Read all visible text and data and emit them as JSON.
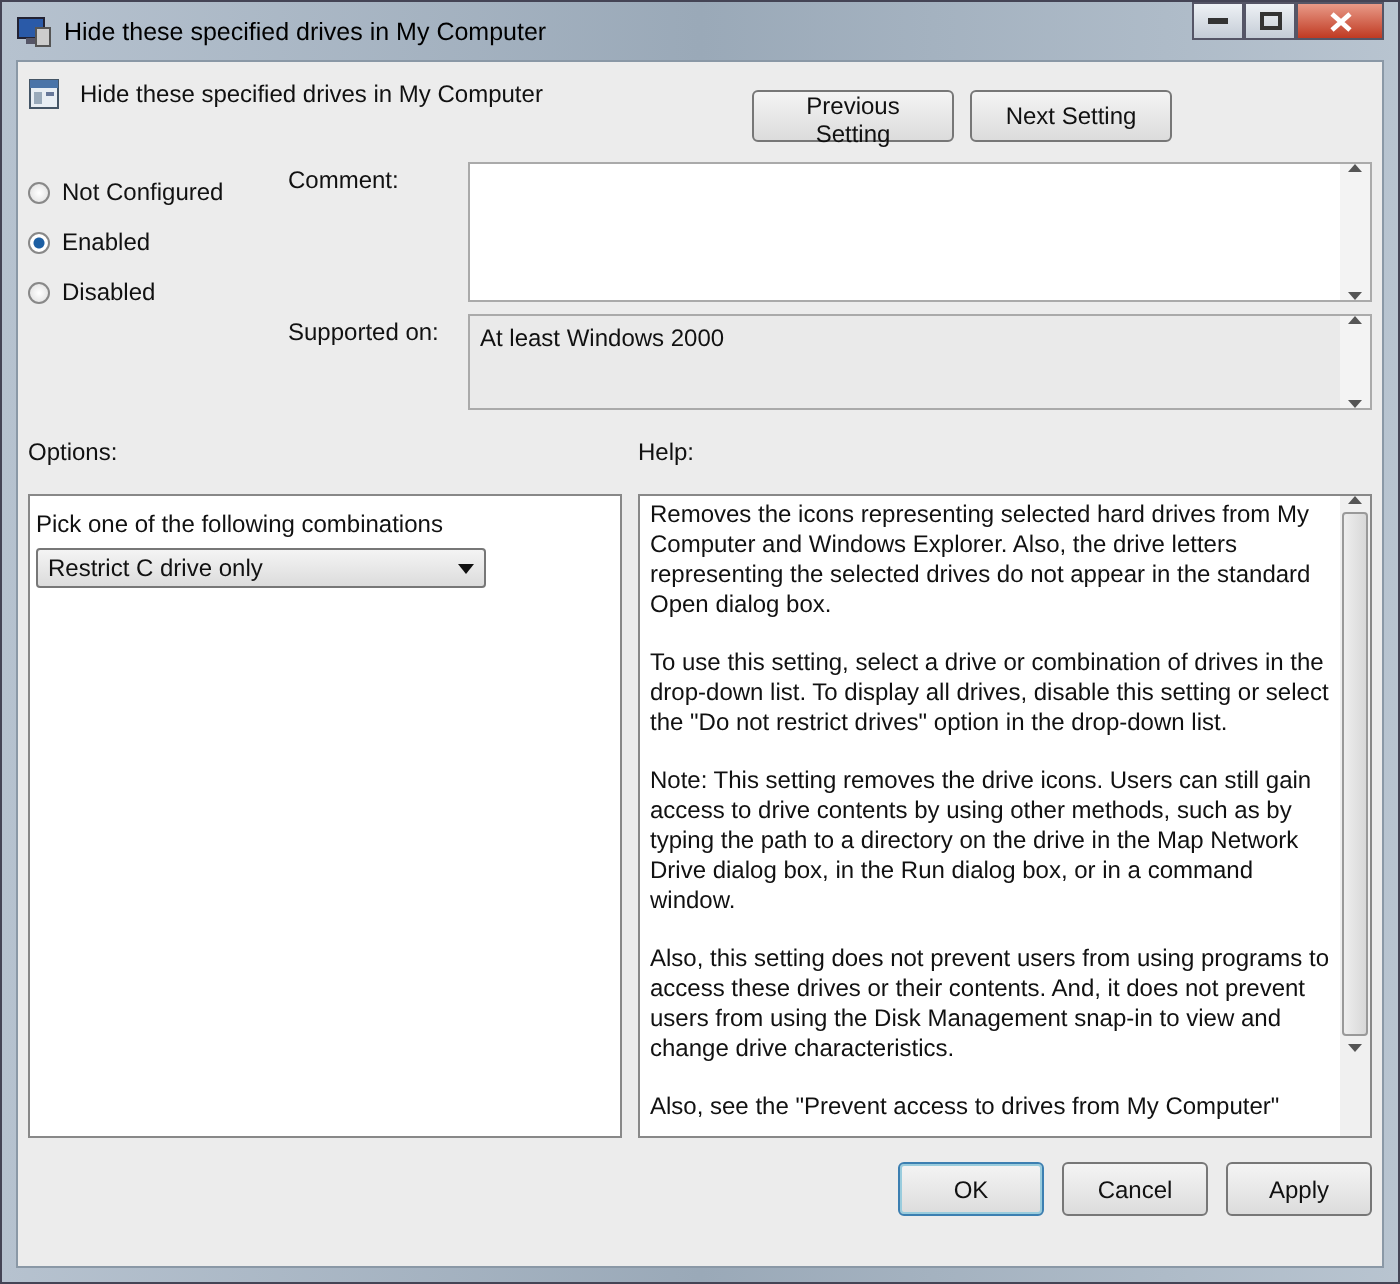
{
  "window": {
    "title": "Hide these specified drives in My Computer"
  },
  "header": {
    "title": "Hide these specified drives in My Computer"
  },
  "nav_buttons": [
    "Previous Setting",
    "Next Setting"
  ],
  "states": [
    {
      "label": "Not Configured",
      "selected": false
    },
    {
      "label": "Enabled",
      "selected": true
    },
    {
      "label": "Disabled",
      "selected": false
    }
  ],
  "comment": {
    "label": "Comment:"
  },
  "supported_on": {
    "label": "Supported on:",
    "value": "At least Windows 2000"
  },
  "options": {
    "label": "Options:",
    "prompt": "Pick one of the following combinations",
    "dropdown": "Restrict C drive only"
  },
  "help": {
    "label": "Help:",
    "paragraphs": [
      "Removes the icons representing selected hard drives from My Computer and Windows Explorer. Also, the drive letters representing the selected drives do not appear in the standard Open dialog box.",
      "To use this setting, select a drive or combination of drives in the drop-down list. To display all drives, disable this setting or select the \"Do not restrict drives\" option in the drop-down list.",
      "Note: This setting removes the drive icons. Users can still gain access to drive contents by using other methods, such as by typing the path to a directory on the drive in the Map Network Drive dialog box, in the Run dialog box, or in a command window.",
      "Also, this setting does not prevent users from using programs to access these drives or their contents. And, it does not prevent users from using the Disk Management snap-in to view and change drive characteristics.",
      "Also, see the \"Prevent access to drives from My Computer\""
    ]
  },
  "buttons": [
    "OK",
    "Cancel",
    "Apply"
  ]
}
